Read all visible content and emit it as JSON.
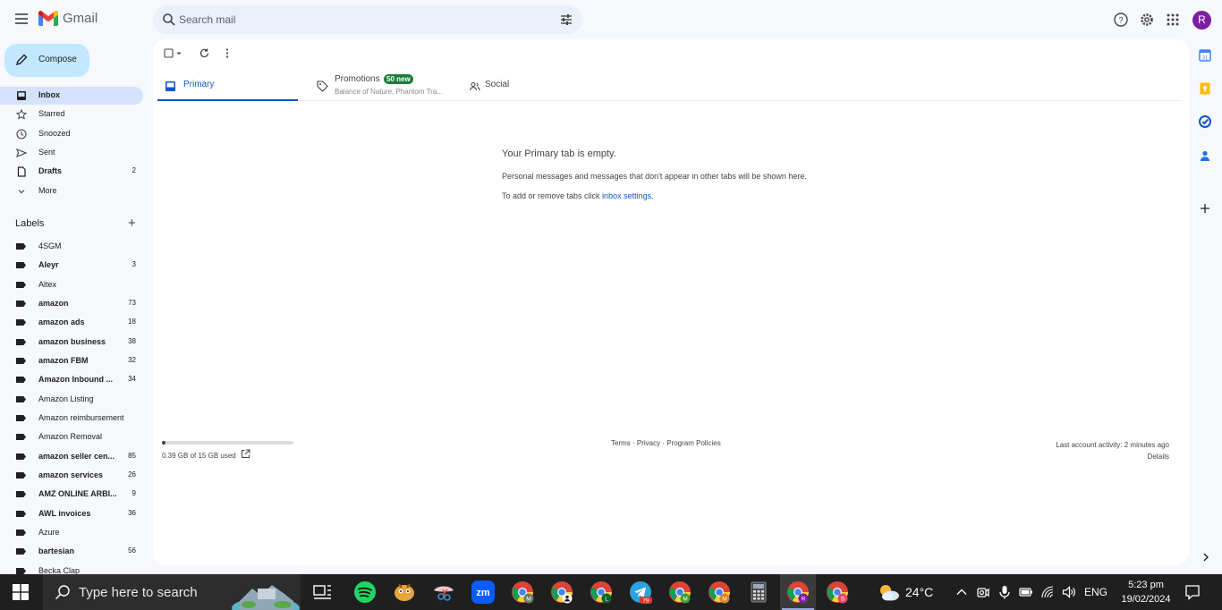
{
  "app": {
    "name": "Gmail",
    "search_placeholder": "Search mail",
    "avatar_letter": "R"
  },
  "sidebar": {
    "compose_label": "Compose",
    "nav": [
      {
        "label": "Inbox",
        "count": "",
        "bold": true,
        "active": true,
        "icon": "inbox-icon"
      },
      {
        "label": "Starred",
        "count": "",
        "bold": false,
        "active": false,
        "icon": "star-icon"
      },
      {
        "label": "Snoozed",
        "count": "",
        "bold": false,
        "active": false,
        "icon": "clock-icon"
      },
      {
        "label": "Sent",
        "count": "",
        "bold": false,
        "active": false,
        "icon": "send-icon"
      },
      {
        "label": "Drafts",
        "count": "2",
        "bold": true,
        "active": false,
        "icon": "draft-icon"
      },
      {
        "label": "More",
        "count": "",
        "bold": false,
        "active": false,
        "icon": "chevron-down-icon"
      }
    ],
    "labels_title": "Labels",
    "labels": [
      {
        "label": "4SGM",
        "count": "",
        "bold": false
      },
      {
        "label": "Aleyr",
        "count": "3",
        "bold": true
      },
      {
        "label": "Altex",
        "count": "",
        "bold": false
      },
      {
        "label": "amazon",
        "count": "73",
        "bold": true
      },
      {
        "label": "amazon ads",
        "count": "18",
        "bold": true
      },
      {
        "label": "amazon business",
        "count": "38",
        "bold": true
      },
      {
        "label": "amazon FBM",
        "count": "32",
        "bold": true
      },
      {
        "label": "Amazon Inbound ...",
        "count": "34",
        "bold": true
      },
      {
        "label": "Amazon Listing",
        "count": "",
        "bold": false
      },
      {
        "label": "Amazon reimbursement",
        "count": "",
        "bold": false
      },
      {
        "label": "Amazon Removal",
        "count": "",
        "bold": false
      },
      {
        "label": "amazon seller cen...",
        "count": "85",
        "bold": true
      },
      {
        "label": "amazon services",
        "count": "26",
        "bold": true
      },
      {
        "label": "AMZ ONLINE ARBI...",
        "count": "9",
        "bold": true
      },
      {
        "label": "AWL invoices",
        "count": "36",
        "bold": true
      },
      {
        "label": "Azure",
        "count": "",
        "bold": false
      },
      {
        "label": "bartesian",
        "count": "56",
        "bold": true
      },
      {
        "label": "Becka Clap",
        "count": "",
        "bold": false
      }
    ]
  },
  "main": {
    "tabs": [
      {
        "label": "Primary"
      },
      {
        "label": "Promotions",
        "badge": "50 new",
        "subtitle": "Balance of Nature, Phantom Tra..."
      },
      {
        "label": "Social"
      }
    ],
    "empty_title": "Your Primary tab is empty.",
    "empty_message": "Personal messages and messages that don't appear in other tabs will be shown here.",
    "settings_prefix": "To add or remove tabs click ",
    "settings_link": "inbox settings",
    "settings_suffix": ".",
    "storage_text": "0.39 GB of 15 GB used",
    "storage_fraction": 0.026,
    "footer": {
      "terms": "Terms",
      "privacy": "Privacy",
      "policies": "Program Policies",
      "sep": " · "
    },
    "activity": "Last account activity: 2 minutes ago",
    "details": "Details"
  },
  "taskbar": {
    "search_placeholder": "Type here to search",
    "temperature": "24°C",
    "language": "ENG",
    "time": "5:23 pm",
    "date": "19/02/2024",
    "telegram_badge": "79"
  },
  "colors": {
    "accent": "#0b57d0",
    "compose_bg": "#c2e7ff",
    "active_nav": "#d3e3fd",
    "promo_badge": "#188038",
    "avatar": "#7b1fa2"
  }
}
